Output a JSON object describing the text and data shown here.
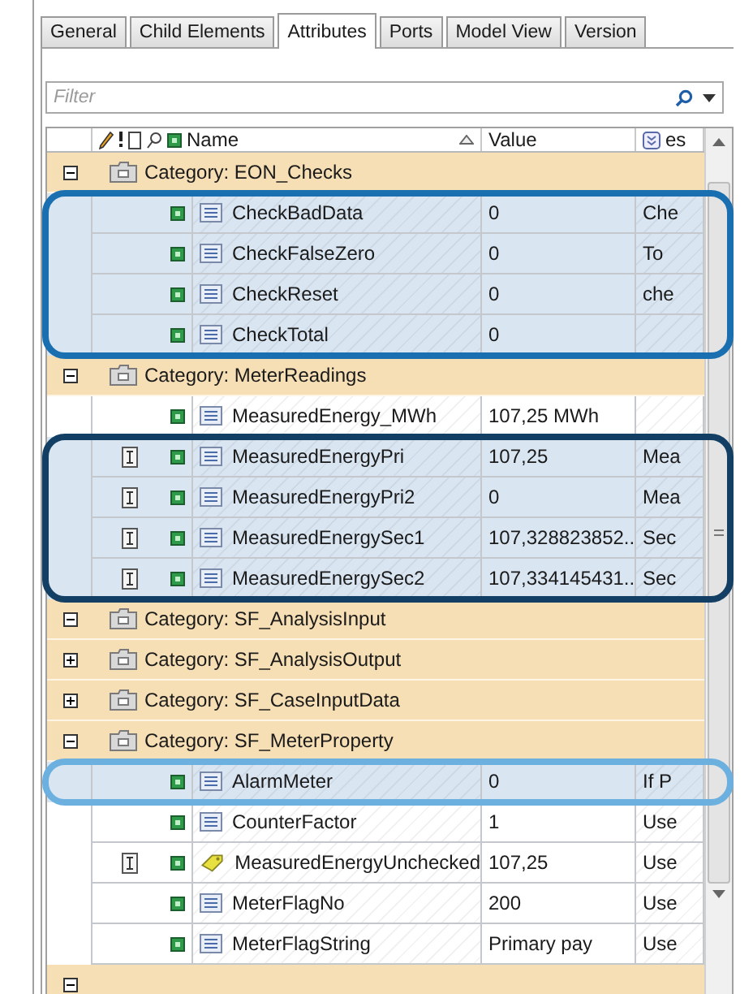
{
  "tabs": [
    {
      "label": "General",
      "selected": false
    },
    {
      "label": "Child Elements",
      "selected": false
    },
    {
      "label": "Attributes",
      "selected": true
    },
    {
      "label": "Ports",
      "selected": false
    },
    {
      "label": "Model View",
      "selected": false
    },
    {
      "label": "Version",
      "selected": false
    }
  ],
  "filter": {
    "placeholder": "Filter"
  },
  "columns": {
    "name": "Name",
    "value": "Value",
    "description": "es"
  },
  "categories": [
    {
      "name": "Category: EON_Checks",
      "expanded": true,
      "blocks": [
        {
          "color": "#1a6fb0",
          "items": [
            {
              "kind": "attribute",
              "linked": false,
              "name": "CheckBadData",
              "value": "0",
              "description": "Che"
            },
            {
              "kind": "attribute",
              "linked": false,
              "name": "CheckFalseZero",
              "value": "0",
              "description": "To"
            },
            {
              "kind": "attribute",
              "linked": false,
              "name": "CheckReset",
              "value": "0",
              "description": "che"
            },
            {
              "kind": "attribute",
              "linked": false,
              "name": "CheckTotal",
              "value": "0"
            }
          ]
        }
      ]
    },
    {
      "name": "Category: MeterReadings",
      "expanded": true,
      "blocks": [
        {
          "items": [
            {
              "kind": "attribute",
              "linked": false,
              "name": "MeasuredEnergy_MWh",
              "value": "107,25 MWh"
            }
          ]
        },
        {
          "color": "#123f63",
          "items": [
            {
              "kind": "attribute",
              "linked": true,
              "name": "MeasuredEnergyPri",
              "value": "107,25",
              "description": "Mea"
            },
            {
              "kind": "attribute",
              "linked": true,
              "name": "MeasuredEnergyPri2",
              "value": "0",
              "description": "Mea"
            },
            {
              "kind": "attribute",
              "linked": true,
              "name": "MeasuredEnergySec1",
              "value": "107,328823852...",
              "description": "Sec"
            },
            {
              "kind": "attribute",
              "linked": true,
              "name": "MeasuredEnergySec2",
              "value": "107,334145431...",
              "description": "Sec"
            }
          ]
        }
      ]
    },
    {
      "name": "Category: SF_AnalysisInput",
      "expanded": true
    },
    {
      "name": "Category: SF_AnalysisOutput",
      "expanded": false
    },
    {
      "name": "Category: SF_CaseInputData",
      "expanded": false
    },
    {
      "name": "Category: SF_MeterProperty",
      "expanded": true,
      "blocks": [
        {
          "color": "#6cb0e0",
          "items": [
            {
              "kind": "attribute",
              "linked": false,
              "name": "AlarmMeter",
              "value": "0",
              "description": "If P"
            }
          ]
        },
        {
          "items": [
            {
              "kind": "attribute",
              "linked": false,
              "name": "CounterFactor",
              "value": "1",
              "description": "Use"
            },
            {
              "kind": "reference",
              "linked": true,
              "name": "MeasuredEnergyUnchecked",
              "value": "107,25",
              "description": "Use"
            },
            {
              "kind": "attribute",
              "linked": false,
              "name": "MeterFlagNo",
              "value": "200",
              "description": "Use"
            },
            {
              "kind": "attribute",
              "linked": false,
              "name": "MeterFlagString",
              "value": "Primary pay",
              "description": "Use"
            }
          ]
        }
      ]
    },
    {
      "expanded": true
    }
  ]
}
